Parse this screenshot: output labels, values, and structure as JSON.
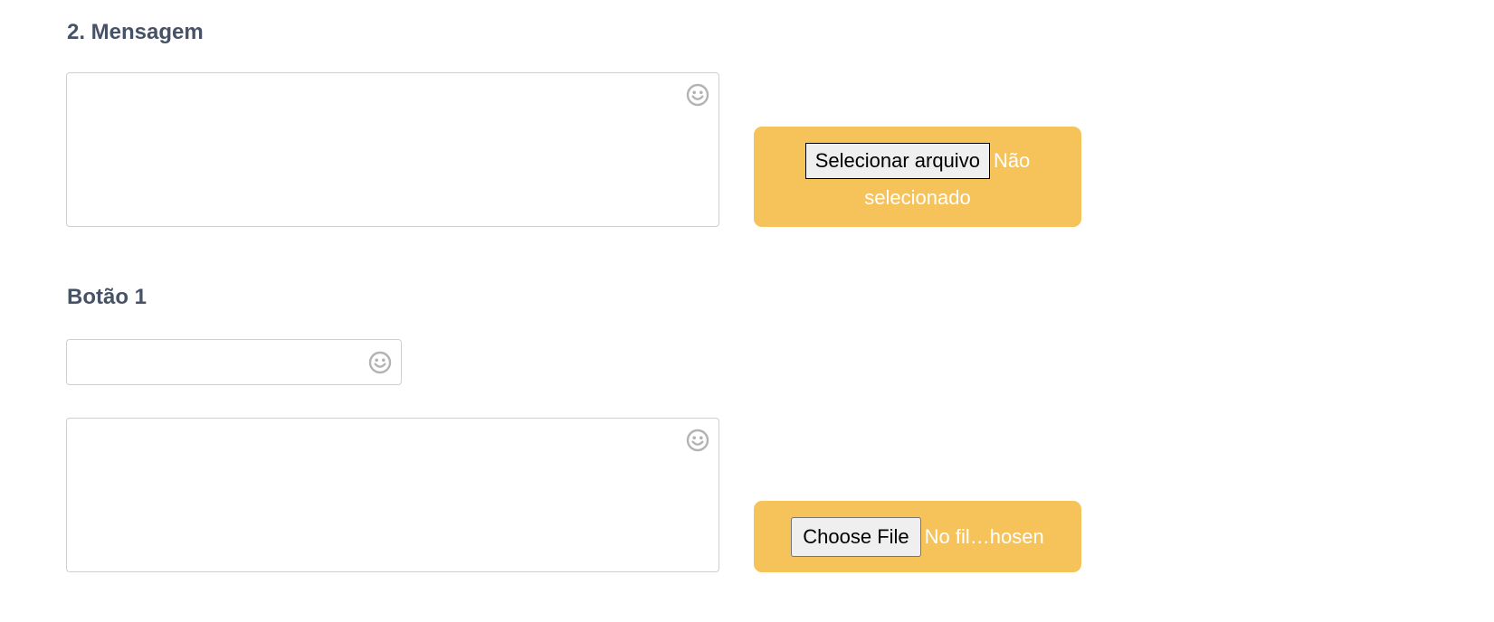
{
  "section_message": {
    "heading": "2. Mensagem",
    "message_value": "",
    "emoji_icon": "smiley-icon",
    "upload": {
      "button_label": "Selecionar arquivo",
      "status": "Não selecionado"
    }
  },
  "section_button": {
    "heading": "Botão 1",
    "title_value": "",
    "text_value": "",
    "emoji_icon": "smiley-icon",
    "upload": {
      "button_label": "Choose File",
      "status": "No fil…hosen"
    }
  },
  "colors": {
    "heading": "#475266",
    "upload_background": "#f5c35a",
    "field_border": "#cfcfcf",
    "emoji_icon": "#b3b3b3"
  }
}
